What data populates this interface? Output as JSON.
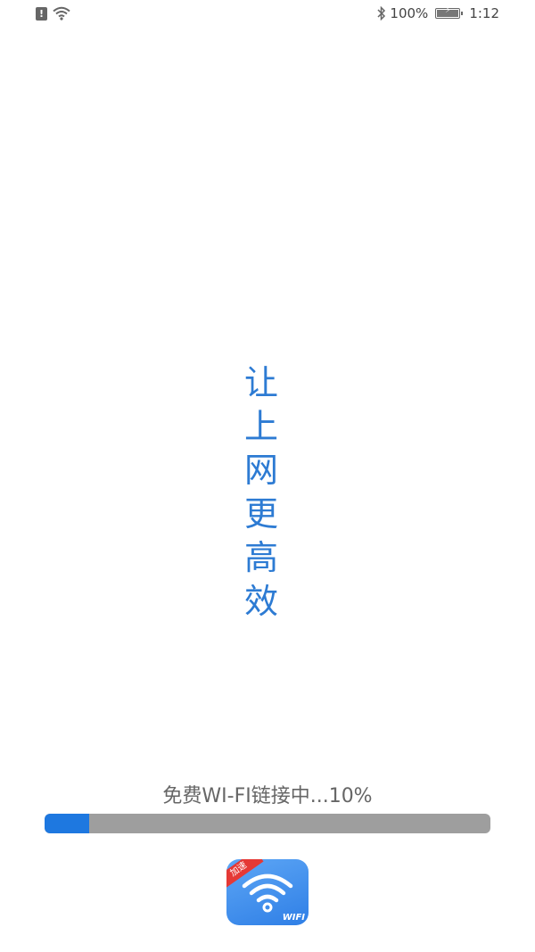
{
  "status_bar": {
    "battery_percent": "100%",
    "time": "1:12",
    "battery_level": 1.0,
    "icons": [
      "sim-alert-icon",
      "wifi-icon",
      "bluetooth-icon",
      "battery-icon"
    ]
  },
  "splash": {
    "slogan": [
      "让",
      "上",
      "网",
      "更",
      "高",
      "效"
    ],
    "slogan_color": "#2d7bd3"
  },
  "loading": {
    "text": "免费WI-FI链接中...10%",
    "progress": 0.1,
    "fill_color": "#1e78e0",
    "track_color": "#9e9e9e"
  },
  "app_icon": {
    "badge": "加速",
    "label": "WIFI",
    "icon": "wifi-icon"
  }
}
